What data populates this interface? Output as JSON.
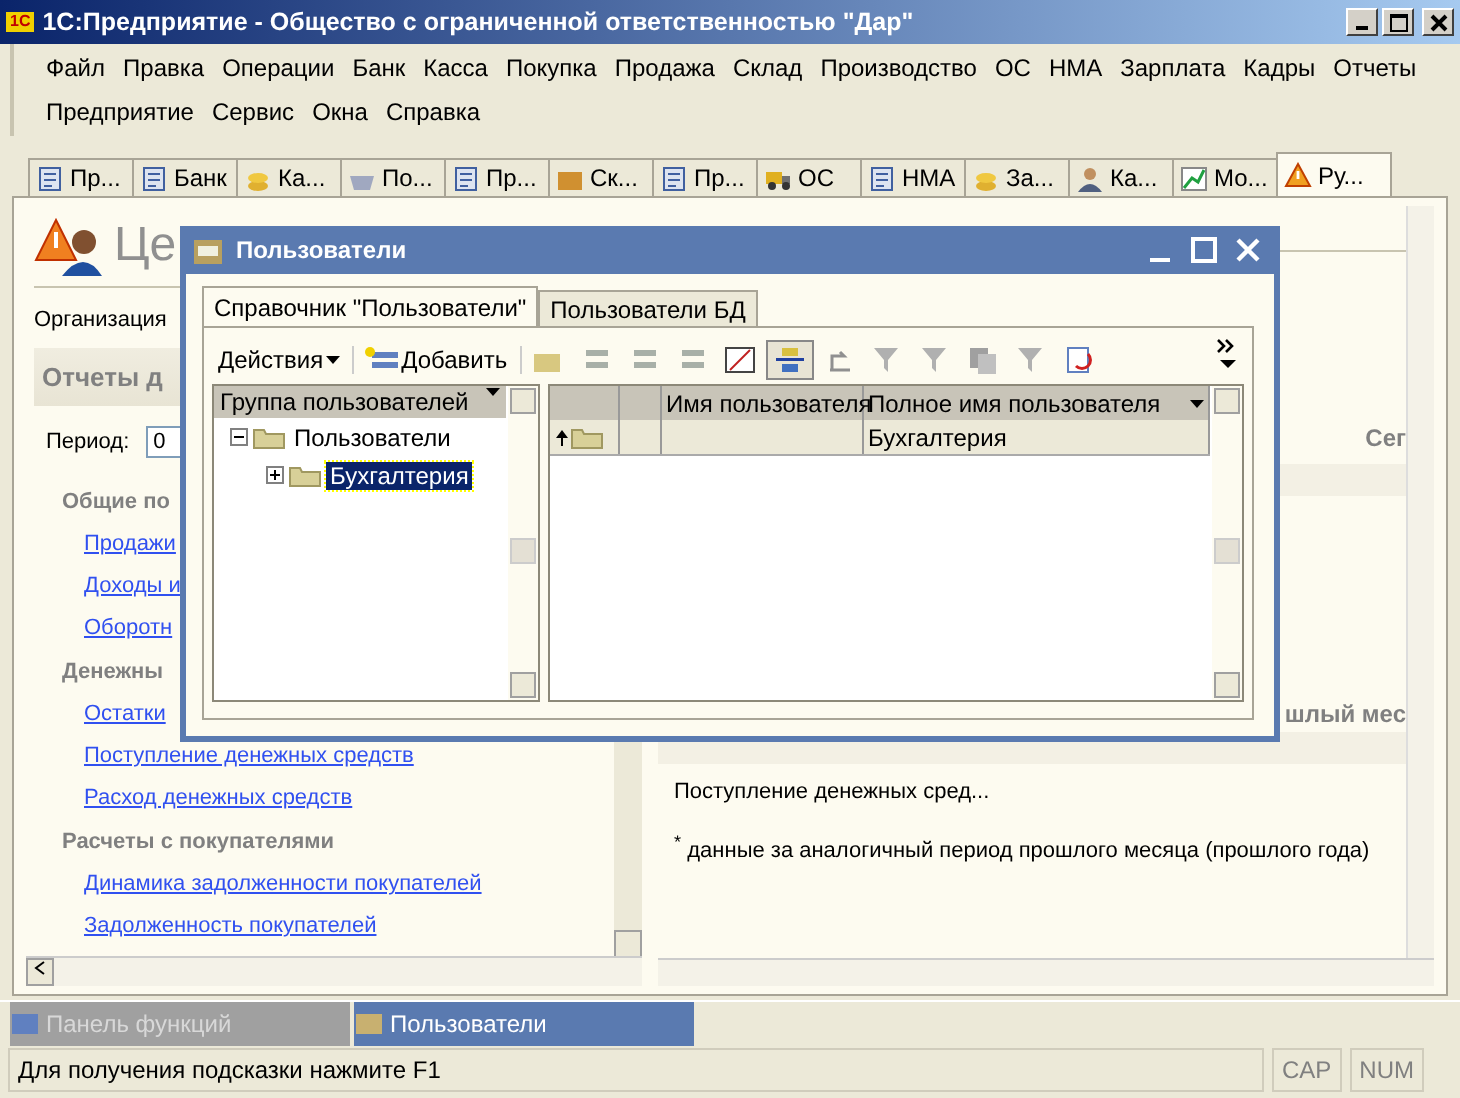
{
  "window": {
    "title": "1С:Предприятие - Общество с ограниченной ответственностью \"Дар\"",
    "logo": "1С"
  },
  "menu_rows": [
    [
      "Файл",
      "Правка",
      "Операции",
      "Банк",
      "Касса",
      "Покупка",
      "Продажа",
      "Склад",
      "Производство",
      "ОС",
      "НМА",
      "Зарплата",
      "Кадры",
      "Отчеты"
    ],
    [
      "Предприятие",
      "Сервис",
      "Окна",
      "Справка"
    ]
  ],
  "tabs": [
    {
      "label": "Пр...",
      "selected": false,
      "kind": "doc"
    },
    {
      "label": "Банк",
      "selected": false,
      "kind": "doc"
    },
    {
      "label": "Ка...",
      "selected": false,
      "kind": "coins"
    },
    {
      "label": "По...",
      "selected": false,
      "kind": "basket"
    },
    {
      "label": "Пр...",
      "selected": false,
      "kind": "doc"
    },
    {
      "label": "Ск...",
      "selected": false,
      "kind": "box"
    },
    {
      "label": "Пр...",
      "selected": false,
      "kind": "doc"
    },
    {
      "label": "ОС",
      "selected": false,
      "kind": "truck"
    },
    {
      "label": "НМА",
      "selected": false,
      "kind": "doc"
    },
    {
      "label": "За...",
      "selected": false,
      "kind": "coins"
    },
    {
      "label": "Ка...",
      "selected": false,
      "kind": "person"
    },
    {
      "label": "Мо...",
      "selected": false,
      "kind": "chart"
    },
    {
      "label": "Ру...",
      "selected": true,
      "kind": "warning"
    }
  ],
  "left_panel": {
    "heading": "Це",
    "organization_label": "Организация",
    "section": "Отчеты д",
    "period_label": "Период:",
    "period_value": "0",
    "groups": [
      {
        "title": "Общие по",
        "links": [
          "Продажи",
          "Доходы и",
          "Оборотн"
        ]
      },
      {
        "title": "Денежны",
        "links": [
          "Остатки",
          "Поступление денежных средств",
          "Расход денежных средств"
        ]
      },
      {
        "title": "Расчеты с покупателями",
        "links": [
          "Динамика задолженности покупателей",
          "Задолженность покупателей"
        ]
      }
    ]
  },
  "right_panel": {
    "column_label": "Сег",
    "section_fragment": "шлый мес",
    "row_text": "Поступление денежных сред...",
    "footnote_mark": "*",
    "footnote": "данные за аналогичный период прошлого месяца (прошлого года)"
  },
  "dialog": {
    "title": "Пользователи",
    "tabs": [
      {
        "label": "Справочник \"Пользователи\"",
        "selected": true
      },
      {
        "label": "Пользователи БД",
        "selected": false
      }
    ],
    "actions_label": "Действия",
    "add_label": "Добавить",
    "tree_header": "Группа пользователей",
    "tree": [
      {
        "label": "Пользователи",
        "expanded": true,
        "selected": false,
        "children": [
          {
            "label": "Бухгалтерия",
            "expanded": false,
            "selected": true
          }
        ]
      }
    ],
    "columns": [
      "",
      "",
      "Имя пользователя",
      "Полное имя пользователя"
    ],
    "rows": [
      {
        "full_name": "Бухгалтерия"
      }
    ]
  },
  "taskbar": [
    {
      "label": "Панель функций",
      "selected": false
    },
    {
      "label": "Пользователи",
      "selected": true
    }
  ],
  "status_bar": {
    "hint": "Для получения подсказки нажмите F1",
    "indicators": [
      "CAP",
      "NUM"
    ]
  }
}
